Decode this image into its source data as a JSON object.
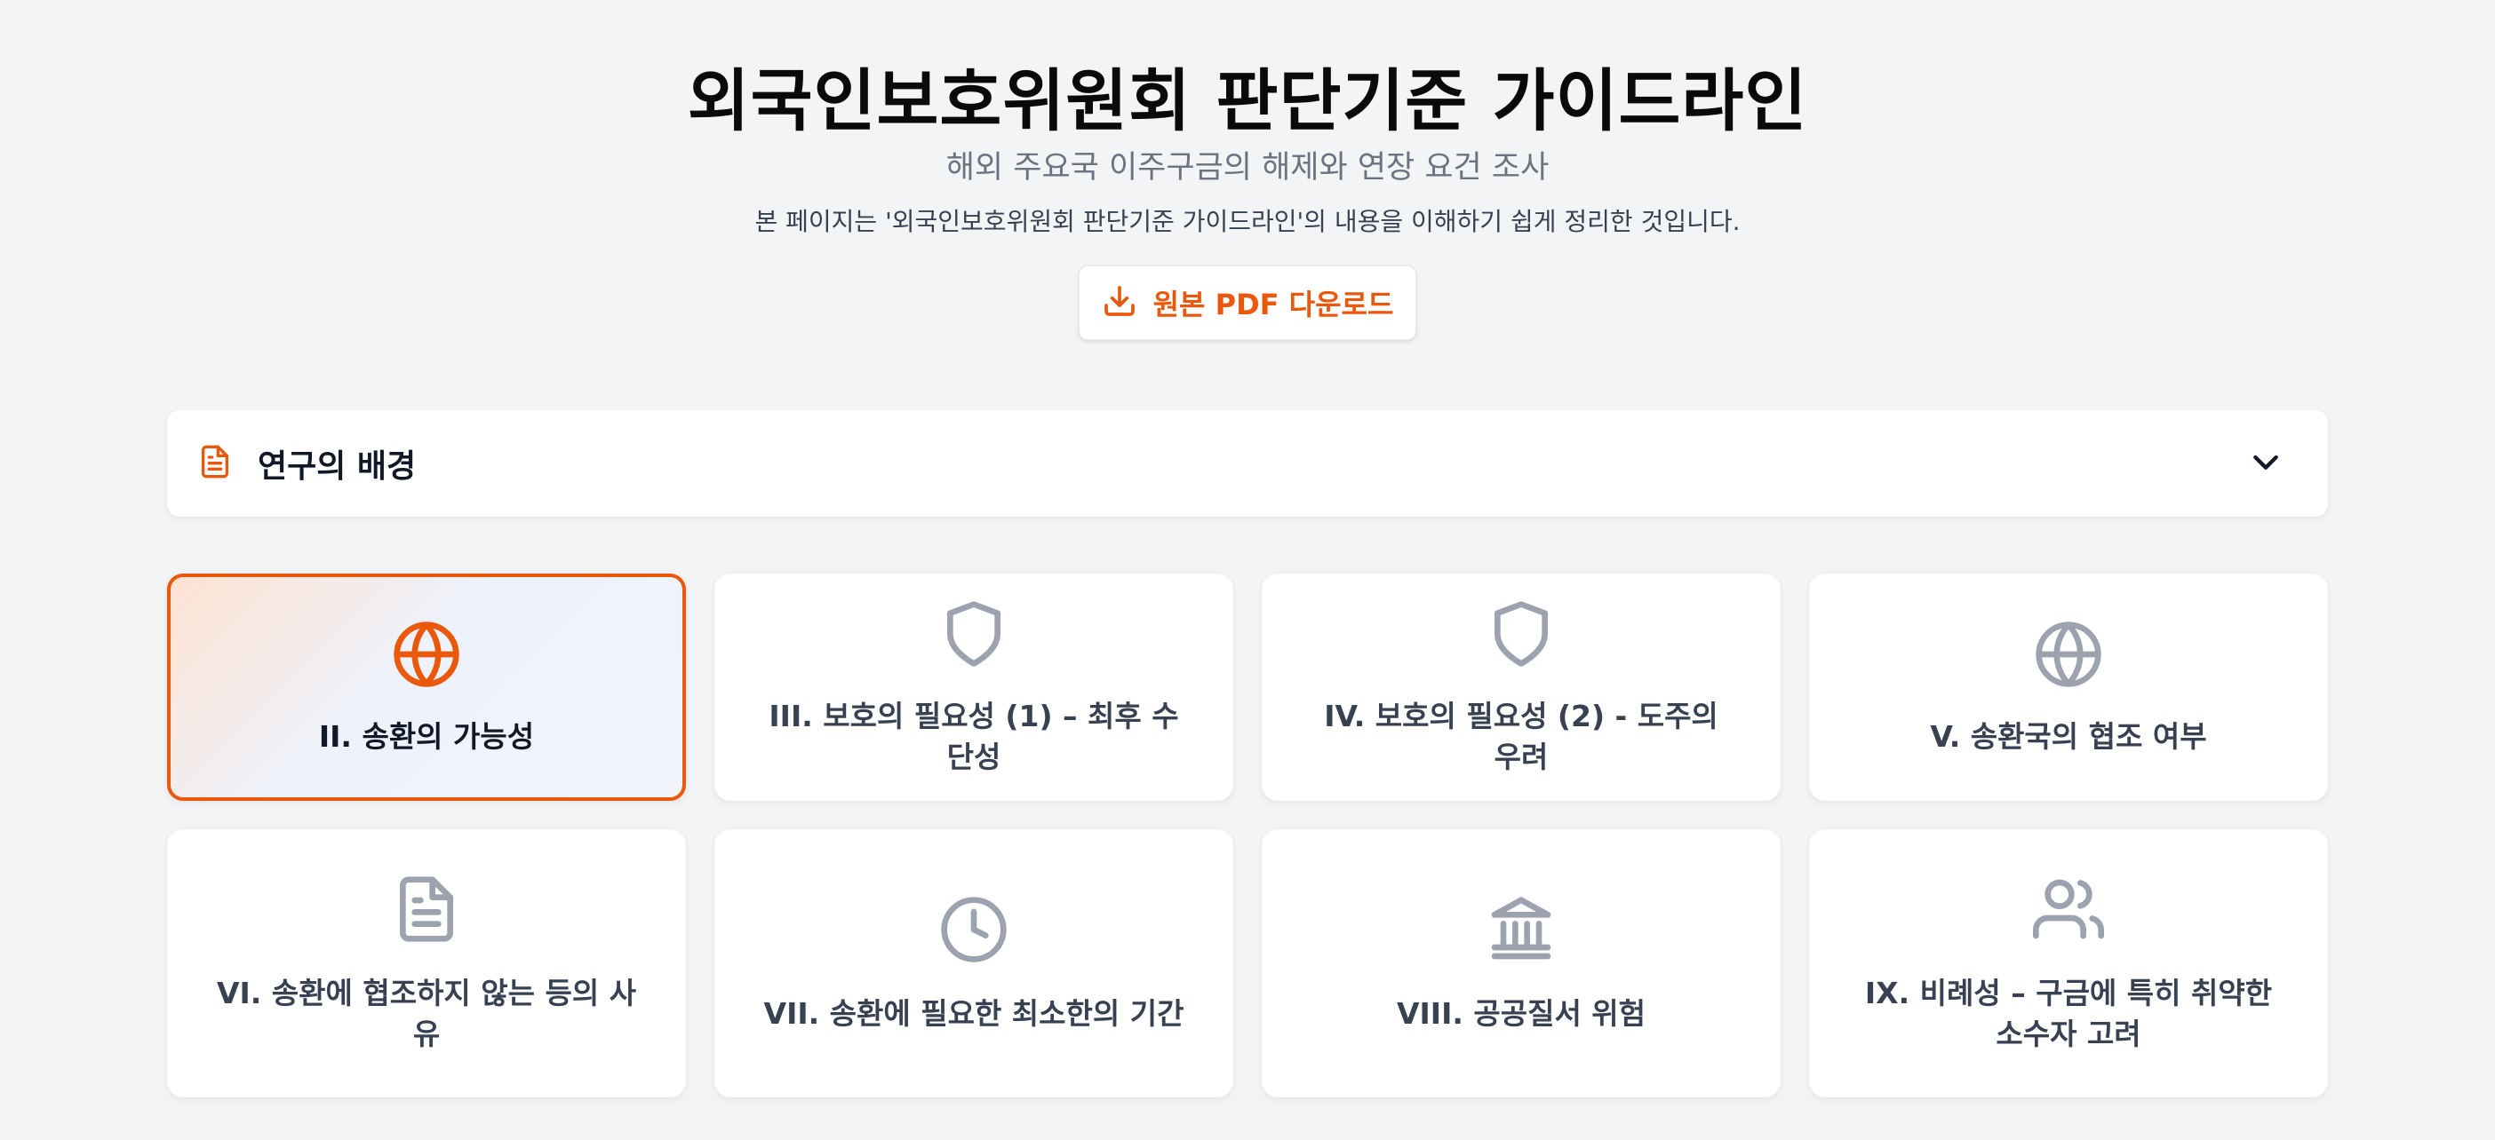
{
  "header": {
    "title": "외국인보호위원회 판단기준 가이드라인",
    "subtitle": "해외 주요국 이주구금의 해제와 연장 요건 조사",
    "note": "본 페이지는 '외국인보호위원회 판단기준 가이드라인'의 내용을 이해하기 쉽게 정리한 것입니다.",
    "download_label": "원본 PDF 다운로드",
    "download_icon": "download-icon"
  },
  "accordion": {
    "title": "연구의 배경",
    "icon": "document-icon",
    "toggle_icon": "chevron-down-icon"
  },
  "colors": {
    "accent": "#ea580c",
    "icon_inactive": "#9ca3af",
    "background": "#f3f4f6"
  },
  "cards": [
    {
      "label": "II. 송환의 가능성",
      "icon": "globe-icon",
      "active": true
    },
    {
      "label": "III. 보호의 필요성 (1) – 최후 수단성",
      "icon": "shield-icon",
      "active": false
    },
    {
      "label": "IV. 보호의 필요성 (2) - 도주의 우려",
      "icon": "shield-icon",
      "active": false
    },
    {
      "label": "V. 송환국의 협조 여부",
      "icon": "globe-icon",
      "active": false
    },
    {
      "label": "VI. 송환에 협조하지 않는 등의 사유",
      "icon": "document-icon",
      "active": false
    },
    {
      "label": "VII. 송환에 필요한 최소한의 기간",
      "icon": "clock-icon",
      "active": false
    },
    {
      "label": "VIII. 공공질서 위험",
      "icon": "bank-icon",
      "active": false
    },
    {
      "label": "IX. 비례성 – 구금에 특히 취약한 소수자 고려",
      "icon": "users-icon",
      "active": false
    }
  ]
}
